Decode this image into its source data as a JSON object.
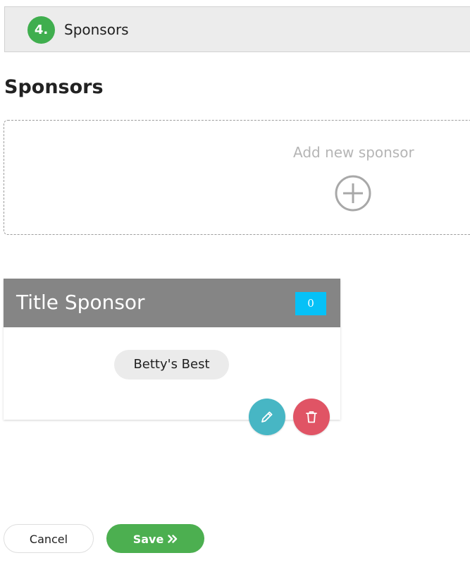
{
  "step": {
    "number": "4.",
    "title": "Sponsors",
    "badge_color": "#3fae4e"
  },
  "page": {
    "title": "Sponsors"
  },
  "add_sponsor": {
    "label": "Add new sponsor",
    "icon": "plus-circle-icon"
  },
  "sponsor_level": {
    "title": "Title Sponsor",
    "count": "0",
    "count_color": "#06c1f7",
    "header_color": "#858585",
    "sponsors": [
      {
        "name": "Betty's Best"
      }
    ],
    "actions": {
      "edit_icon": "pencil-icon",
      "edit_color": "#47b6c4",
      "delete_icon": "trash-icon",
      "delete_color": "#e05465"
    }
  },
  "footer": {
    "cancel_label": "Cancel",
    "save_label": "Save",
    "save_icon": "double-chevron-right-icon",
    "save_color": "#4caf50"
  }
}
